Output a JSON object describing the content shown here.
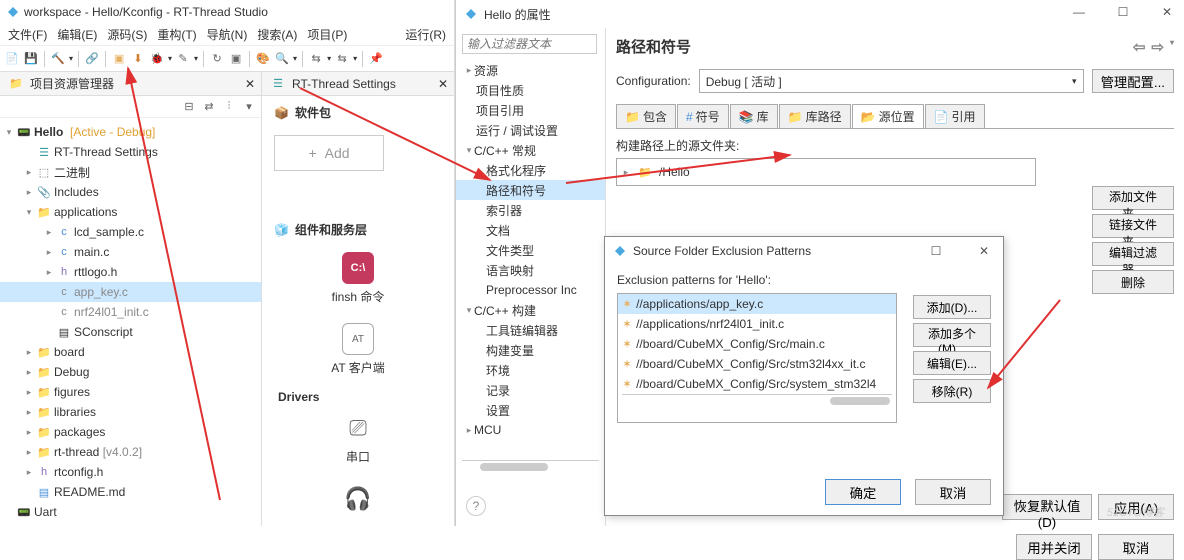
{
  "main": {
    "title": "workspace - Hello/Kconfig - RT-Thread Studio",
    "menu": [
      "文件(F)",
      "编辑(E)",
      "源码(S)",
      "重构(T)",
      "导航(N)",
      "搜索(A)",
      "项目(P)",
      "运行(R)"
    ]
  },
  "explorer": {
    "title": "项目资源管理器",
    "project": "Hello",
    "active": "[Active - Debug]",
    "items": {
      "rtset": "RT-Thread Settings",
      "bin": "二进制",
      "inc": "Includes",
      "apps": "applications",
      "lcd": "lcd_sample.c",
      "mainc": "main.c",
      "rtt": "rttlogo.h",
      "appkey": "app_key.c",
      "nrf": "nrf24l01_init.c",
      "scons": "SConscript",
      "board": "board",
      "debug": "Debug",
      "figs": "figures",
      "libs": "libraries",
      "pkgs": "packages",
      "rtthread": "rt-thread",
      "rtver": "[v4.0.2]",
      "rtcfg": "rtconfig.h",
      "readme": "README.md",
      "uart": "Uart"
    }
  },
  "settings": {
    "tab": "RT-Thread Settings",
    "software": "软件包",
    "add": "Add",
    "comps": "组件和服务层",
    "finsh": "finsh 命令",
    "at": "AT 客户端",
    "drivers": "Drivers",
    "serial": "串口"
  },
  "prop": {
    "title": "Hello 的属性",
    "filter": "输入过滤器文本",
    "tree": {
      "res": "资源",
      "nature": "项目性质",
      "ref": "项目引用",
      "rundbg": "运行 / 调试设置",
      "ccgen": "C/C++ 常规",
      "fmt": "格式化程序",
      "path": "路径和符号",
      "idx": "索引器",
      "doc": "文档",
      "ftype": "文件类型",
      "lang": "语言映射",
      "pre": "Preprocessor Inc",
      "ccbuild": "C/C++ 构建",
      "tce": "工具链编辑器",
      "bvar": "构建变量",
      "env": "环境",
      "log": "记录",
      "set": "设置",
      "mcu": "MCU"
    },
    "heading": "路径和符号",
    "config_label": "Configuration:",
    "config_value": "Debug  [ 活动 ]",
    "manage": "管理配置...",
    "tabs": {
      "inc": "包含",
      "sym": "符号",
      "lib": "库",
      "libp": "库路径",
      "src": "源位置",
      "ref": "引用"
    },
    "src_label": "构建路径上的源文件夹:",
    "src_item": "/Hello",
    "btns": {
      "addf": "添加文件夹...",
      "link": "链接文件夹...",
      "editf": "编辑过滤器...",
      "del": "删除"
    },
    "restore": "恢复默认值(D)",
    "apply": "应用(A)",
    "applyclose": "用并关闭",
    "cancel": "取消"
  },
  "dialog": {
    "title": "Source Folder Exclusion Patterns",
    "label": "Exclusion patterns for 'Hello':",
    "patterns": [
      "//applications/app_key.c",
      "//applications/nrf24l01_init.c",
      "//board/CubeMX_Config/Src/main.c",
      "//board/CubeMX_Config/Src/stm32l4xx_it.c",
      "//board/CubeMX_Config/Src/system_stm32l4"
    ],
    "btns": {
      "add": "添加(D)...",
      "addm": "添加多个(M)...",
      "edit": "编辑(E)...",
      "rem": "移除(R)"
    },
    "ok": "确定",
    "cancel": "取消"
  },
  "watermark": "51CTO博客"
}
